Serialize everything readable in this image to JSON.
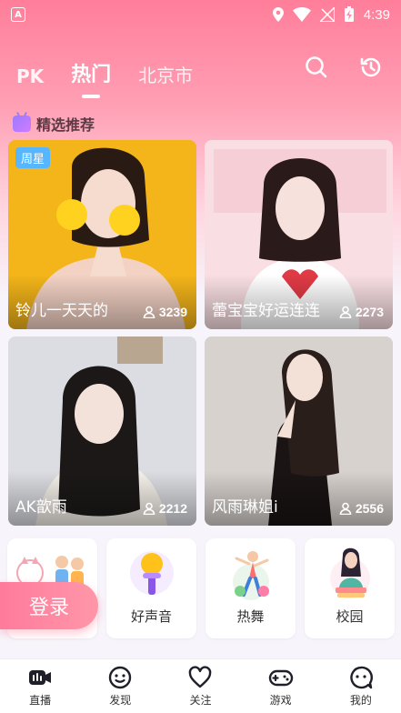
{
  "status_bar": {
    "app_badge": "A",
    "time": "4:39"
  },
  "top_tabs": [
    {
      "label": "PK"
    },
    {
      "label": "热门"
    },
    {
      "label": "北京市"
    }
  ],
  "section": {
    "title": "精选推荐"
  },
  "cards": [
    {
      "badge": "周星",
      "name": "铃儿一天天的",
      "viewers": "3239"
    },
    {
      "name": "蕾宝宝好运连连",
      "viewers": "2273"
    },
    {
      "name": "AK歆雨",
      "viewers": "2212"
    },
    {
      "name": "风雨琳姐i",
      "viewers": "2556"
    }
  ],
  "categories": [
    {
      "label": ""
    },
    {
      "label": "好声音"
    },
    {
      "label": "热舞"
    },
    {
      "label": "校园"
    }
  ],
  "login_button": "登录",
  "bottom_nav": [
    {
      "label": "直播"
    },
    {
      "label": "发现"
    },
    {
      "label": "关注"
    },
    {
      "label": "游戏"
    },
    {
      "label": "我的"
    }
  ]
}
